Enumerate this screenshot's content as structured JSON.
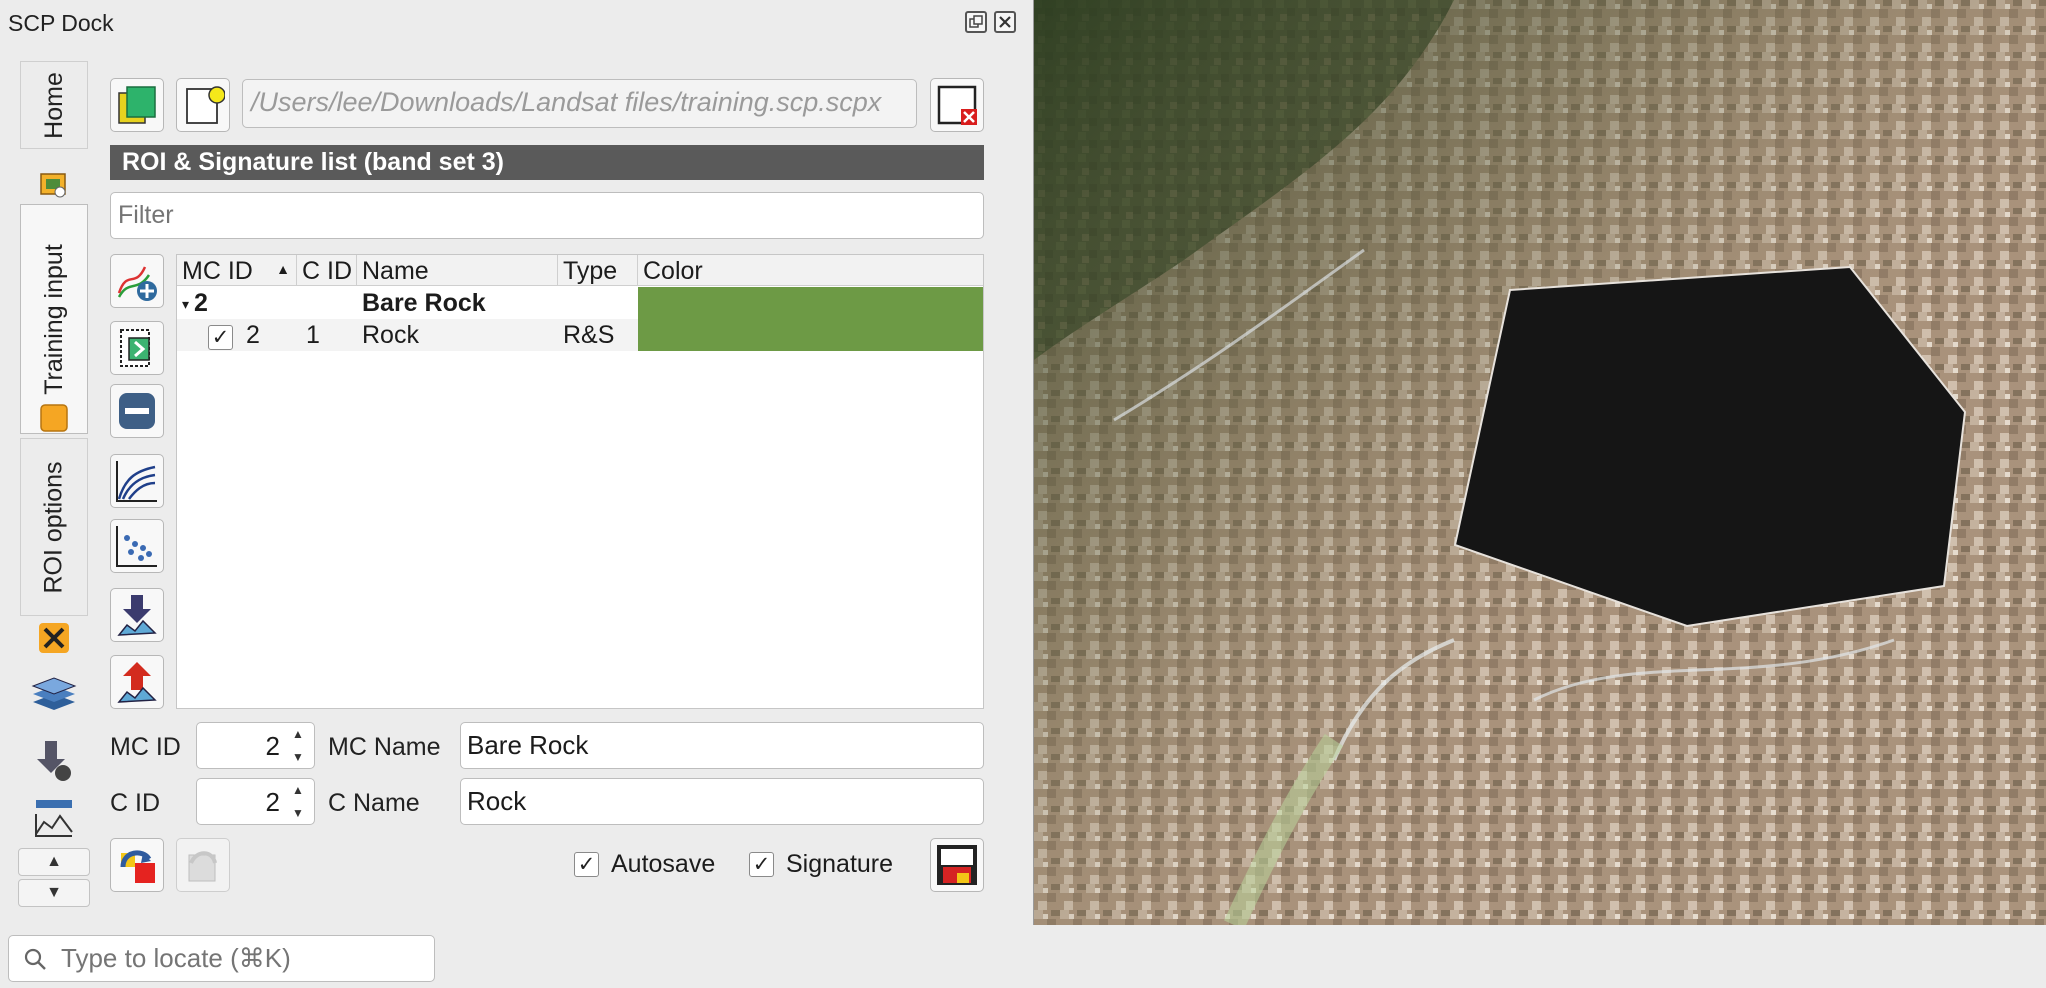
{
  "dock": {
    "title": "SCP Dock",
    "tabs": [
      {
        "label": "Home"
      },
      {
        "label": "Training input"
      },
      {
        "label": "ROI options"
      }
    ]
  },
  "training": {
    "file_path": "/Users/lee/Downloads/Landsat files/training.scp.scpx",
    "list_title": "ROI & Signature list (band set 3)",
    "filter_placeholder": "Filter",
    "columns": [
      "MC ID",
      "C ID",
      "Name",
      "Type",
      "Color"
    ],
    "rows": [
      {
        "mc_id": "2",
        "c_id": "",
        "name": "Bare Rock",
        "type": "",
        "color": "#6d9a45",
        "group": true
      },
      {
        "mc_id": "2",
        "c_id": "1",
        "name": "Rock",
        "type": "R&S",
        "color": "#6d9a45",
        "checked": true,
        "group": false
      }
    ],
    "check_mark": "✓"
  },
  "form": {
    "mc_id_label": "MC ID",
    "mc_id_value": "2",
    "mc_name_label": "MC Name",
    "mc_name_value": "Bare Rock",
    "c_id_label": "C ID",
    "c_id_value": "2",
    "c_name_label": "C Name",
    "c_name_value": "Rock",
    "autosave_label": "Autosave",
    "autosave_checked": "✓",
    "signature_label": "Signature",
    "signature_checked": "✓"
  },
  "locator": {
    "placeholder": "Type to locate (⌘K)"
  },
  "colors": {
    "header_bg": "#5a5a5a",
    "class_color": "#6d9a45",
    "roi_fill": "#151515"
  }
}
